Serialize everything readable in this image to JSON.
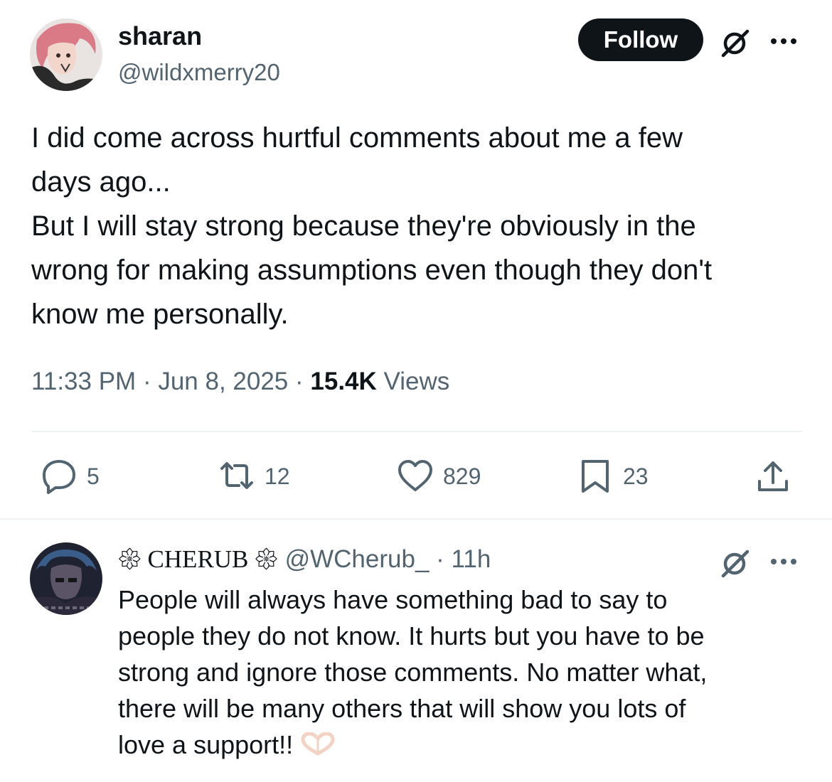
{
  "tweet": {
    "author": {
      "display_name": "sharan",
      "handle": "@wildxmerry20"
    },
    "follow_label": "Follow",
    "text": "I did come across hurtful comments about me a few\ndays ago...\nBut I will stay strong because they're obviously in the\nwrong for making assumptions even though they don't\nknow me personally.",
    "time": "11:33 PM",
    "date": "Jun 8, 2025",
    "separator": "·",
    "views_count": "15.4K",
    "views_label": "Views",
    "actions": {
      "replies": "5",
      "reposts": "12",
      "likes": "829",
      "bookmarks": "23"
    },
    "icons": [
      "grok-icon",
      "more-icon",
      "reply-icon",
      "repost-icon",
      "like-icon",
      "bookmark-icon",
      "share-icon"
    ]
  },
  "reply": {
    "display_name": "𑁍 CHERUB 𑁍",
    "handle": "@WCherub_",
    "separator": "·",
    "time": "11h",
    "text": "People will always have something bad to say to\npeople they do not know. It hurts but you have to be\nstrong and ignore those comments. No matter what,\nthere will be many others that will show you lots of\nlove a support!! ",
    "emoji": "heart-hands-emoji"
  },
  "colors": {
    "text_primary": "#0f1419",
    "text_secondary": "#536471",
    "follow_bg": "#0f1419",
    "divider": "#eff3f4"
  }
}
